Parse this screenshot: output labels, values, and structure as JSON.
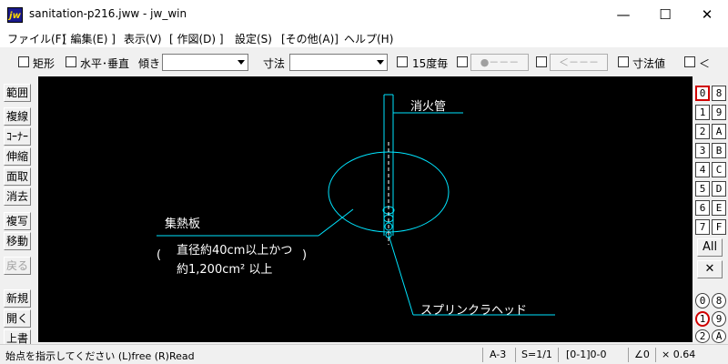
{
  "window": {
    "title": "sanitation-p216.jww - jw_win",
    "icon_label": "jw",
    "icon": "jw-app-icon",
    "minimize": "—",
    "maximize": "☐",
    "close": "✕"
  },
  "menu": [
    "ファイル(F)",
    "[ 編集(E) ]",
    "表示(V)",
    "[ 作図(D) ]",
    "設定(S)",
    "[その他(A)]",
    "ヘルプ(H)"
  ],
  "toolbar": {
    "rect_label": "矩形",
    "hv_label": "水平･垂直",
    "angle_label": "傾き",
    "angle_value": "",
    "dimension_label": "寸法",
    "dimension_value": "",
    "step15_label": "15度毎",
    "circle_btn": "●－－－",
    "arrow_btn": "＜－－－",
    "dimvalue_label": "寸法値",
    "lt_label": "＜"
  },
  "tools": [
    "範囲",
    "複線",
    "ｺｰﾅｰ",
    "伸縮",
    "面取",
    "消去",
    "複写",
    "移動",
    "戻る",
    "新規",
    "開く",
    "上書"
  ],
  "layers": {
    "grid": [
      [
        "0",
        "8"
      ],
      [
        "1",
        "9"
      ],
      [
        "2",
        "A"
      ],
      [
        "3",
        "B"
      ],
      [
        "4",
        "C"
      ],
      [
        "5",
        "D"
      ],
      [
        "6",
        "E"
      ],
      [
        "7",
        "F"
      ]
    ],
    "all_label": "All",
    "x_label": "✕",
    "groups": [
      [
        "0",
        "8"
      ],
      [
        "1",
        "9"
      ],
      [
        "2",
        "A"
      ]
    ]
  },
  "drawing": {
    "label_pipe": "消火管",
    "label_collector": "集熱板",
    "note_paren_open": "(",
    "note_line1": "直径約40cm以上かつ",
    "note_line2": "約1,200cm² 以上",
    "note_paren_close": ")",
    "label_sprinkler": "スプリンクラヘッド",
    "line_color": "#00e5ff",
    "text_color": "#ffffff"
  },
  "status": {
    "message": "始点を指示してください (L)free (R)Read",
    "paper": "A-3",
    "scale": "S=1/1",
    "layer": "[0-1]0-0",
    "angle": "∠0",
    "zoom": "× 0.64"
  }
}
